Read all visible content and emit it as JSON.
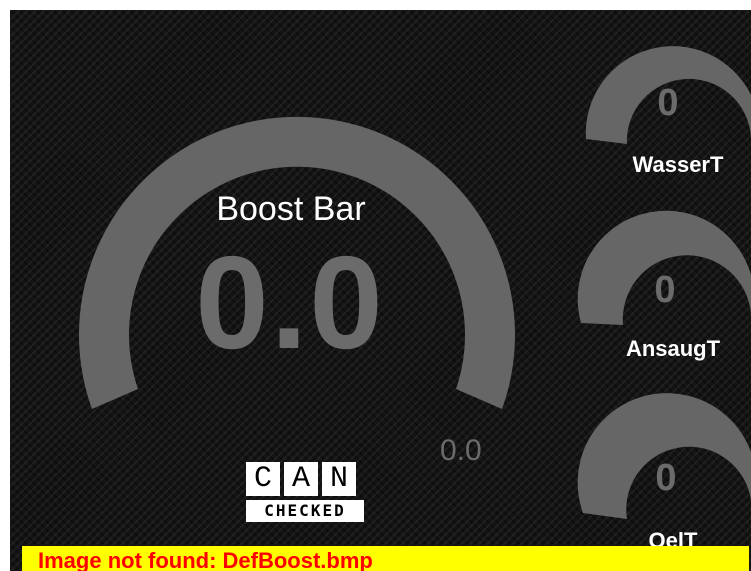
{
  "main_gauge": {
    "title": "Boost Bar",
    "value": "0.0",
    "secondary_value": "0.0"
  },
  "side_gauges": [
    {
      "value": "0",
      "label": "WasserT"
    },
    {
      "value": "0",
      "label": "AnsaugT"
    },
    {
      "value": "0",
      "label": "OelT"
    }
  ],
  "logo": {
    "letters": [
      "C",
      "A",
      "N"
    ],
    "subtitle": "CHECKED"
  },
  "error": {
    "message": "Image not found: DefBoost.bmp"
  },
  "colors": {
    "gauge_arc": "#666666",
    "background": "#141414",
    "value_text": "#6b6b6b",
    "label_text": "#ffffff",
    "error_bg": "#ffff00",
    "error_text": "#ff0000"
  }
}
